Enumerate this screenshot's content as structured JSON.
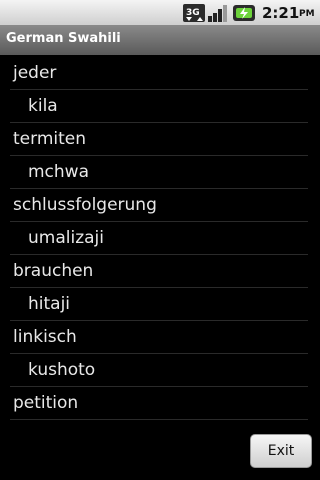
{
  "status": {
    "network_label": "3G",
    "time": "2:21",
    "ampm": "PM",
    "icons": [
      "3g-data-icon",
      "signal-icon",
      "battery-charging-icon"
    ]
  },
  "app": {
    "title": "German Swahili"
  },
  "list": {
    "rows": [
      {
        "word": "jeder",
        "translation": "kila"
      },
      {
        "word": "termiten",
        "translation": "mchwa"
      },
      {
        "word": "schlussfolgerung",
        "translation": "umalizaji"
      },
      {
        "word": "brauchen",
        "translation": "hitaji"
      },
      {
        "word": "linkisch",
        "translation": "kushoto"
      },
      {
        "word": "petition",
        "translation": ""
      }
    ]
  },
  "exit_label": "Exit"
}
